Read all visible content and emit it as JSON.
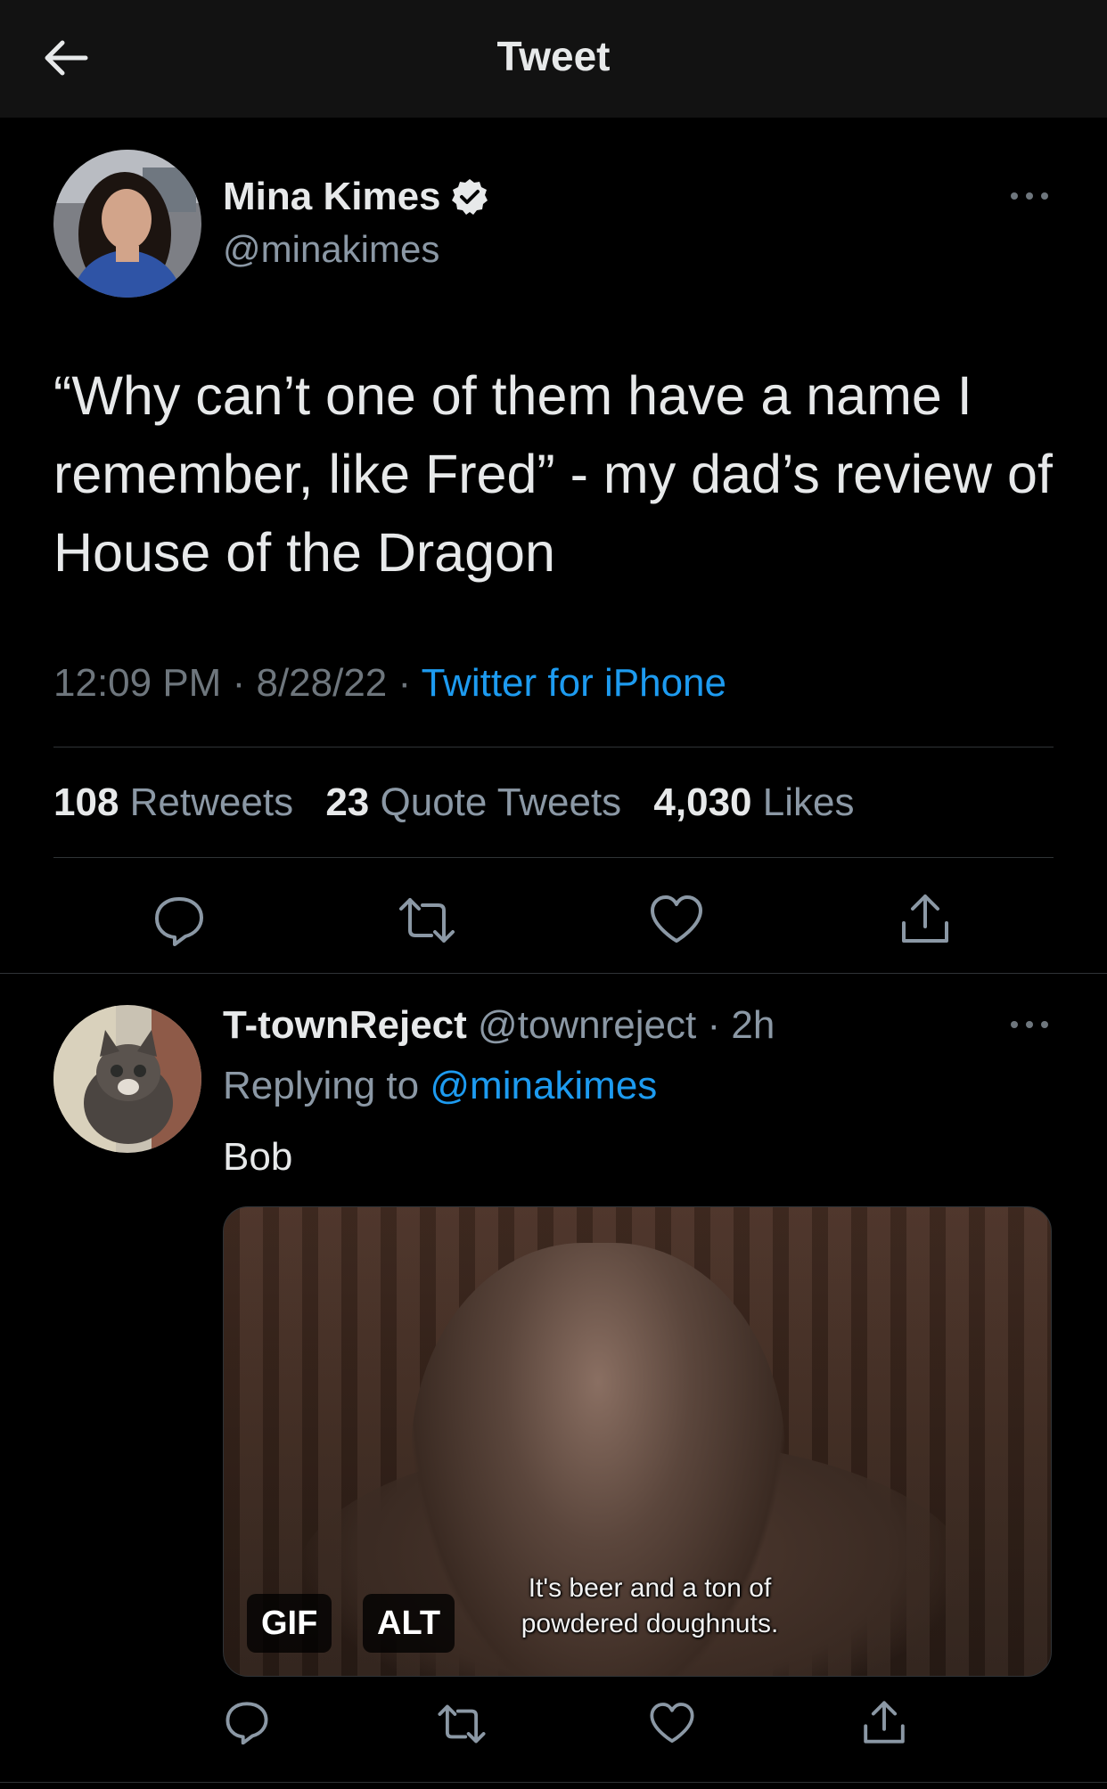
{
  "header": {
    "title": "Tweet",
    "back_icon": "arrow-left-icon"
  },
  "tweet": {
    "author_name": "Mina Kimes",
    "author_handle": "@minakimes",
    "verified_icon": "verified-badge-icon",
    "text": "“Why can’t one of them have a name I remember, like Fred” - my dad’s review of House of the Dragon",
    "time": "12:09 PM",
    "date": "8/28/22",
    "source": "Twitter for iPhone",
    "stats": {
      "retweets_count": "108",
      "retweets_label": "Retweets",
      "quotes_count": "23",
      "quotes_label": "Quote Tweets",
      "likes_count": "4,030",
      "likes_label": "Likes"
    }
  },
  "reply": {
    "author_name": "T-townReject",
    "author_handle": "@townreject",
    "age": "2h",
    "replying_to_label": "Replying to",
    "replying_to_handle": "@minakimes",
    "text": "Bob",
    "media": {
      "caption_line1": "It's beer and a ton of",
      "caption_line2": "powdered doughnuts.",
      "gif_badge": "GIF",
      "alt_badge": "ALT"
    }
  },
  "colors": {
    "background": "#000000",
    "header_background": "#121212",
    "accent": "#1d9bf0",
    "secondary_text": "#8b98a5",
    "divider": "#2f3336"
  }
}
